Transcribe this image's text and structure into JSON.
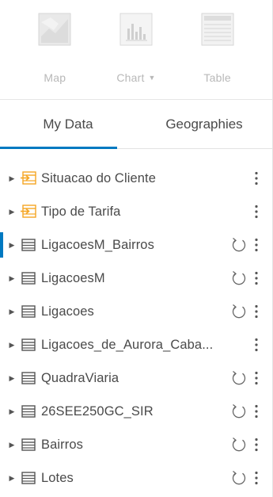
{
  "toolbar": {
    "map_label": "Map",
    "chart_label": "Chart",
    "table_label": "Table"
  },
  "tabs": [
    {
      "label": "My Data",
      "active": true
    },
    {
      "label": "Geographies",
      "active": false
    }
  ],
  "datasets": [
    {
      "name": "Situacao do Cliente",
      "icon": "relationship-table-icon",
      "refresh": false
    },
    {
      "name": "Tipo de Tarifa",
      "icon": "relationship-table-icon",
      "refresh": false
    },
    {
      "name": "LigacoesM_Bairros",
      "icon": "table-icon",
      "refresh": true,
      "selected": true
    },
    {
      "name": "LigacoesM",
      "icon": "table-icon",
      "refresh": true
    },
    {
      "name": "Ligacoes",
      "icon": "table-icon",
      "refresh": true
    },
    {
      "name": "Ligacoes_de_Aurora_Caba...",
      "icon": "table-icon",
      "refresh": false
    },
    {
      "name": "QuadraViaria",
      "icon": "table-icon",
      "refresh": true
    },
    {
      "name": "26SEE250GC_SIR",
      "icon": "table-icon",
      "refresh": true
    },
    {
      "name": "Bairros",
      "icon": "table-icon",
      "refresh": true
    },
    {
      "name": "Lotes",
      "icon": "table-icon",
      "refresh": true
    }
  ],
  "colors": {
    "accent": "#0079c1",
    "relationship_icon": "#f5a623",
    "icon_gray": "#555555"
  }
}
